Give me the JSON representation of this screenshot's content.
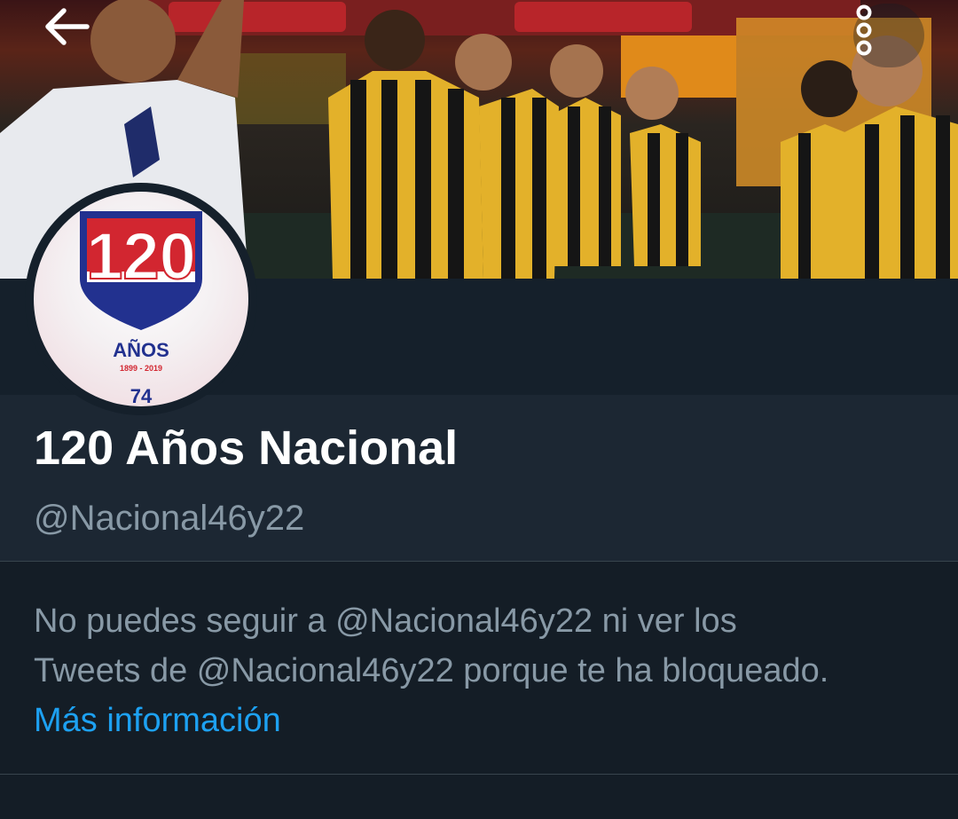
{
  "header": {
    "back_icon": "arrow-left-icon",
    "more_icon": "more-vertical-icon"
  },
  "profile": {
    "display_name": "120 Años Nacional",
    "handle": "@Nacional46y22",
    "avatar": {
      "number": "120",
      "years_label": "AÑOS",
      "date_range": "1899 - 2019",
      "bottom_mark": "74"
    }
  },
  "blocked": {
    "line1": "No puedes seguir a @Nacional46y22 ni ver los",
    "line2": "Tweets de @Nacional46y22 porque te ha bloqueado.",
    "more_info": "Más información"
  },
  "colors": {
    "background": "#15202b",
    "secondary_text": "#8899a6",
    "link": "#1da1f2",
    "avatar_red": "#d22630",
    "avatar_blue": "#22318f"
  }
}
